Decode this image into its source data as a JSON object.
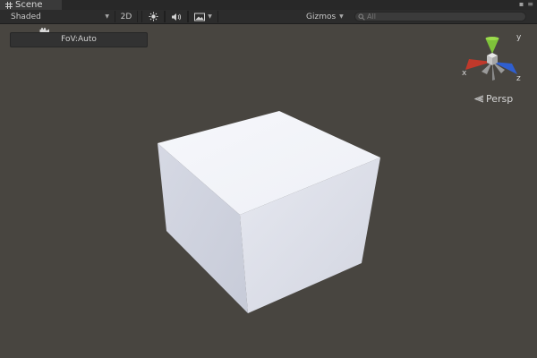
{
  "window": {
    "tab_title": "Scene",
    "tab_icon": "grid-icon",
    "controls": [
      "▪",
      "≡"
    ]
  },
  "toolbar": {
    "shading_mode": "Shaded",
    "mode_2d": "2D",
    "lighting_icon": "sun-icon",
    "audio_icon": "speaker-icon",
    "effects_icon": "image-icon",
    "gizmos_label": "Gizmos",
    "search_icon": "search-icon",
    "search_value": "All"
  },
  "camera": {
    "fov_label": "FoV:Auto",
    "projection_label": "Persp"
  },
  "gizmo": {
    "x_label": "x",
    "y_label": "y",
    "z_label": "z",
    "colors": {
      "x": "#c0392b",
      "y": "#7ec23a",
      "z": "#2f5fd0"
    }
  },
  "colors": {
    "viewport_bg": "#484540",
    "toolbar_bg": "#2c2c2c"
  }
}
